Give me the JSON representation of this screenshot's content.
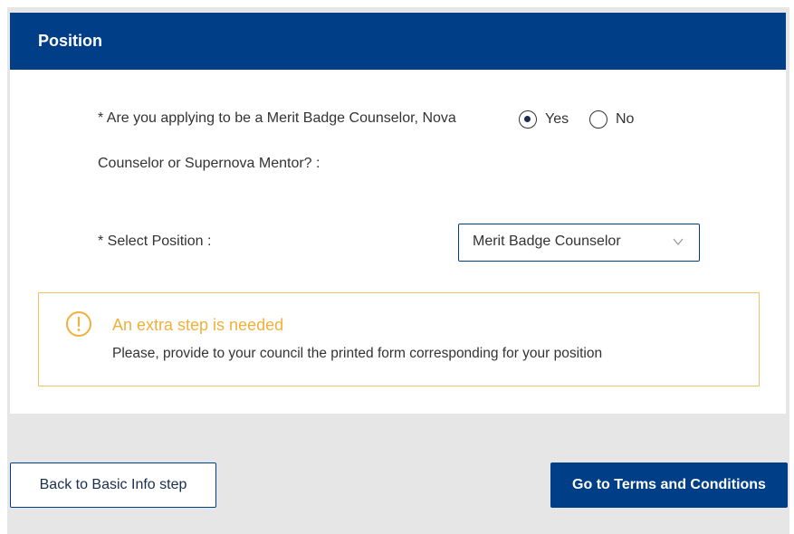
{
  "header": {
    "title": "Position"
  },
  "question": {
    "line1": "* Are you applying to be a Merit Badge Counselor, Nova",
    "line2": "Counselor or Supernova Mentor? :",
    "options": [
      {
        "label": "Yes",
        "selected": true
      },
      {
        "label": "No",
        "selected": false
      }
    ]
  },
  "position": {
    "label": "* Select Position :",
    "selected_value": "Merit Badge Counselor"
  },
  "alert": {
    "icon": "exclamation-circle-icon",
    "title": "An extra step is needed",
    "message": "Please, provide to your council the printed form corresponding for your position"
  },
  "buttons": {
    "back_label": "Back to Basic Info step",
    "next_label": "Go to Terms and Conditions"
  },
  "colors": {
    "primary": "#003f87",
    "warning": "#f2b03a",
    "background": "#e6e6e6"
  }
}
